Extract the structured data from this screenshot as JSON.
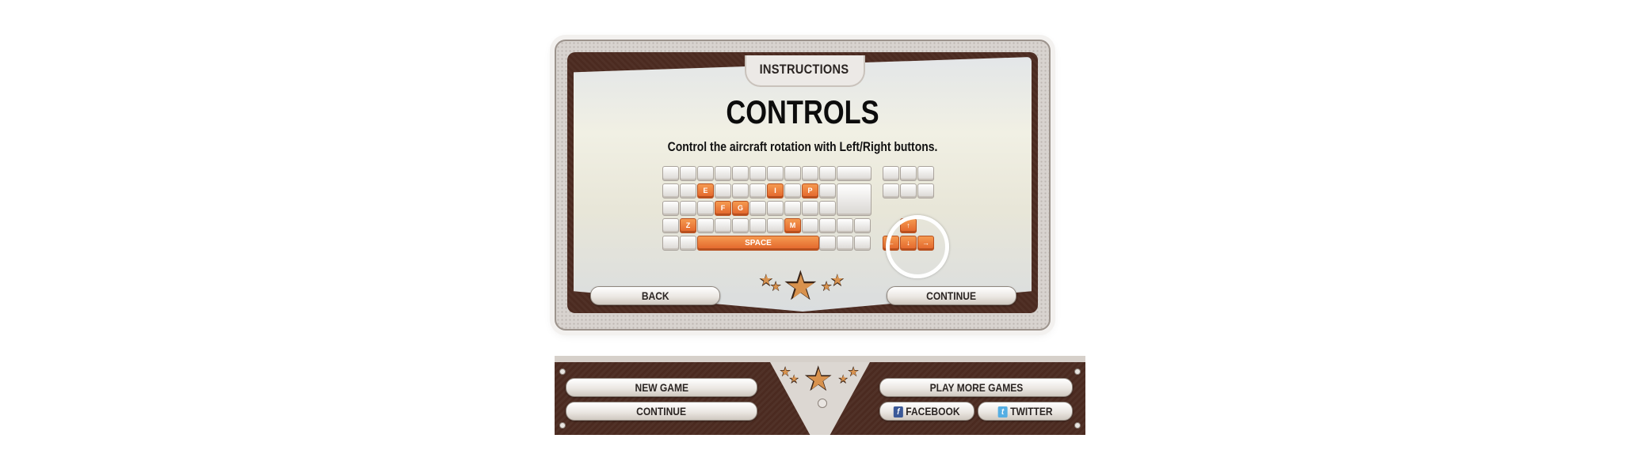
{
  "panel": {
    "tab_title": "INSTRUCTIONS",
    "title": "CONTROLS",
    "subtitle": "Control the aircraft rotation with Left/Right buttons.",
    "back_label": "BACK",
    "continue_label": "CONTINUE"
  },
  "keyboard": {
    "highlighted_keys": [
      "E",
      "I",
      "P",
      "F",
      "G",
      "Z",
      "M"
    ],
    "space_label": "SPACE",
    "arrow_up": "↑",
    "arrow_left": "←",
    "arrow_down": "↓",
    "arrow_right": "→"
  },
  "menu": {
    "new_game_label": "NEW GAME",
    "continue_label": "CONTINUE",
    "play_more_label": "PLAY MORE GAMES",
    "facebook_label": "FACEBOOK",
    "twitter_label": "TWITTER"
  },
  "colors": {
    "frame_brown": "#4b2a20",
    "key_orange": "#e2642a",
    "panel_grey": "#d8d3cf"
  }
}
